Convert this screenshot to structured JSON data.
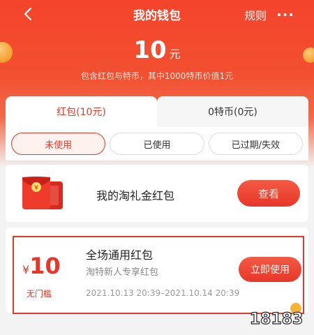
{
  "header": {
    "title": "我的钱包",
    "rules_label": "规则",
    "more_icon": "ellipsis-icon",
    "back_icon": "chevron-left-icon"
  },
  "balance": {
    "amount": "10",
    "unit": "元",
    "subtitle": "包含红包与特币，其中1000特币价值1元"
  },
  "tabs": [
    {
      "label": "红包(10元)",
      "active": true
    },
    {
      "label": "0特币(0元)",
      "active": false
    }
  ],
  "filters": [
    {
      "label": "未使用",
      "active": true
    },
    {
      "label": "已使用",
      "active": false
    },
    {
      "label": "已过期/失效",
      "active": false
    }
  ],
  "gift_card": {
    "name": "我的淘礼金红包",
    "button": "查看"
  },
  "coupon": {
    "currency": "¥",
    "value": "10",
    "threshold": "无门槛",
    "name": "全场通用红包",
    "desc": "淘特新人专享红包",
    "date": "2021.10.13 20:39–2021.10.14 20:39",
    "button": "立即使用"
  },
  "watermark": "18183",
  "colors": {
    "brand": "#e8372a",
    "hero": "#f4442c"
  }
}
